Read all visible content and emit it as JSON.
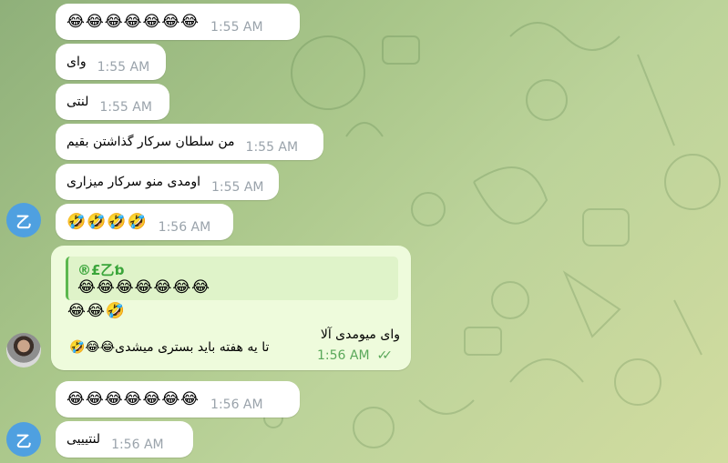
{
  "messages": [
    {
      "text": "😂😂😂😂😂😂😂",
      "time": "1:55 AM"
    },
    {
      "text": "وای",
      "time": "1:55 AM"
    },
    {
      "text": "لنتی",
      "time": "1:55 AM"
    },
    {
      "text": "من سلطان سرکار گذاشتن بقیم",
      "time": "1:55 AM"
    },
    {
      "text": "اومدی منو سرکار میزاری",
      "time": "1:55 AM"
    },
    {
      "text": "🤣🤣🤣🤣",
      "time": "1:56 AM"
    },
    {
      "text": "😂😂😂😂😂😂😂",
      "time": "1:56 AM"
    },
    {
      "text": "لنتیییی",
      "time": "1:56 AM"
    }
  ],
  "avatar_initial": "乙",
  "outgoing": {
    "reply_name": "®£乙ƅ",
    "reply_text": "😂😂😂😂😂😂😂",
    "line1": "😂😂🤣",
    "line2": "وای میومدی آلا",
    "line3": "تا یه هفته باید بستری میشدی😂😂🤣",
    "time": "1:56 AM",
    "check": "✓✓"
  },
  "colors": {
    "incoming": "#ffffff",
    "outgoing": "#eefbdc",
    "accent": "#5cb84f",
    "avatar": "#4fa0e0"
  }
}
